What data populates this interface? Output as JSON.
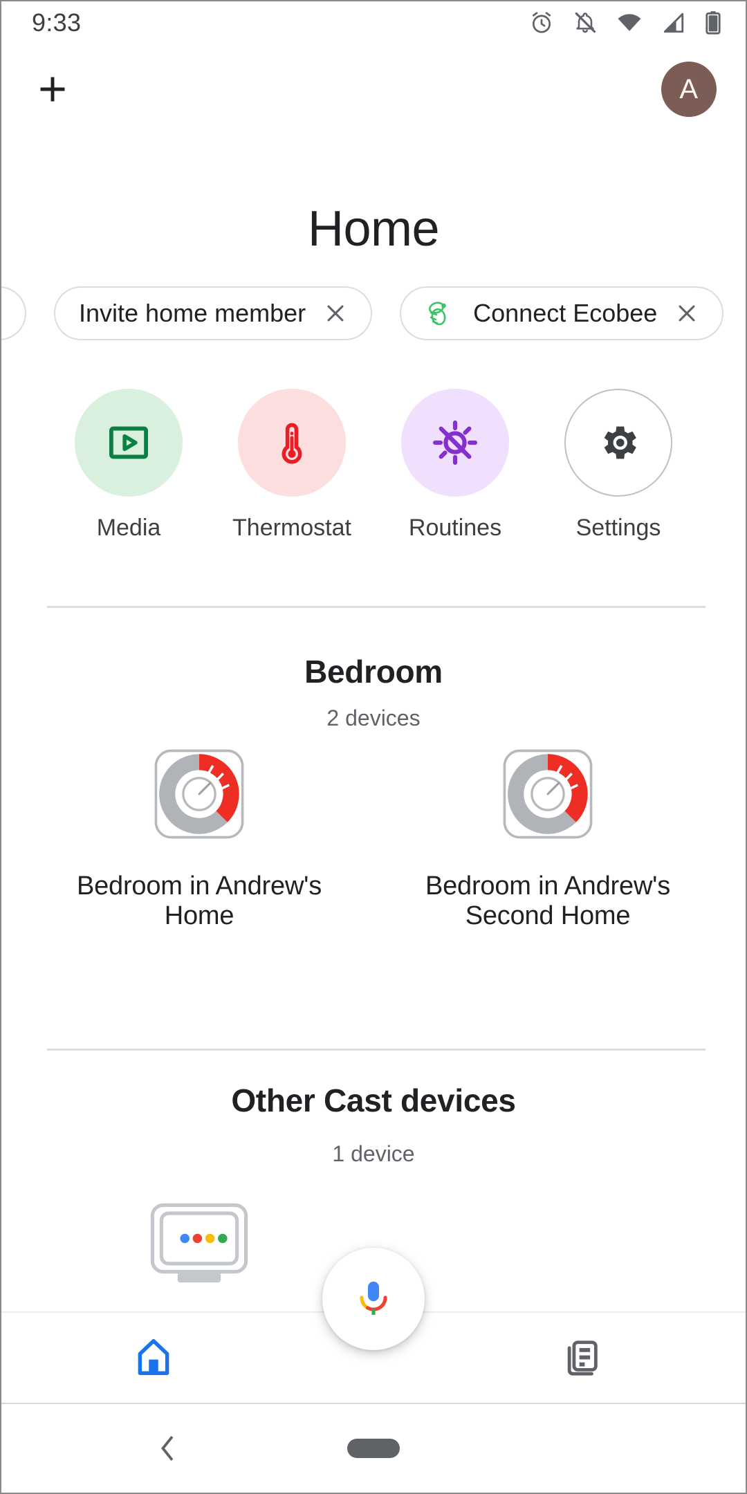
{
  "statusbar": {
    "time": "9:33",
    "icons": [
      "alarm-icon",
      "notifications-off-icon",
      "wifi-icon",
      "cell-signal-icon",
      "battery-icon"
    ]
  },
  "appbar": {
    "add_label": "+",
    "add_icon": "plus-icon",
    "avatar_initial": "A",
    "avatar_color": "#7b5d55"
  },
  "header": {
    "title": "Home"
  },
  "chips": [
    {
      "label": "Invite home member",
      "icon": null,
      "dismiss": "close-icon"
    },
    {
      "label": "Connect Ecobee",
      "icon": "ecobee-bee-icon",
      "dismiss": "close-icon"
    }
  ],
  "quick_actions": [
    {
      "label": "Media",
      "icon": "media-play-icon",
      "bg": "#d9f0de",
      "fg": "#0b8043"
    },
    {
      "label": "Thermostat",
      "icon": "thermometer-icon",
      "bg": "#fbdedd",
      "fg": "#ea1c24"
    },
    {
      "label": "Routines",
      "icon": "routines-sun-icon",
      "bg": "#f0e0fd",
      "fg": "#8430ce"
    },
    {
      "label": "Settings",
      "icon": "gear-icon",
      "bg": "#ffffff",
      "fg": "#3c4043"
    }
  ],
  "sections": [
    {
      "title": "Bedroom",
      "subtitle": "2 devices",
      "devices": [
        {
          "name": "Bedroom in Andrew's Home",
          "icon": "ecobee-thermostat-gauge-icon"
        },
        {
          "name": "Bedroom in Andrew's Second Home",
          "icon": "ecobee-thermostat-gauge-icon"
        }
      ]
    },
    {
      "title": "Other Cast devices",
      "subtitle": "1 device",
      "devices": [
        {
          "name": "",
          "icon": "cast-display-icon"
        }
      ]
    }
  ],
  "fab": {
    "icon": "google-assistant-mic-icon"
  },
  "bottom_nav": [
    {
      "label": "Home",
      "icon": "home-icon",
      "active": true,
      "color": "#1a73e8"
    },
    {
      "label": "Feed",
      "icon": "feed-icon",
      "active": false,
      "color": "#5f6368"
    }
  ],
  "android_nav": {
    "back_icon": "back-chevron-icon",
    "home_pill_icon": "home-pill-icon"
  },
  "colors": {
    "google_blue": "#4285f4",
    "google_red": "#ea4335",
    "google_yellow": "#fbbc04",
    "google_green": "#34a853",
    "gauge_gray": "#b0b3b8",
    "gauge_red": "#ee2e24",
    "accent_blue": "#1a73e8"
  }
}
